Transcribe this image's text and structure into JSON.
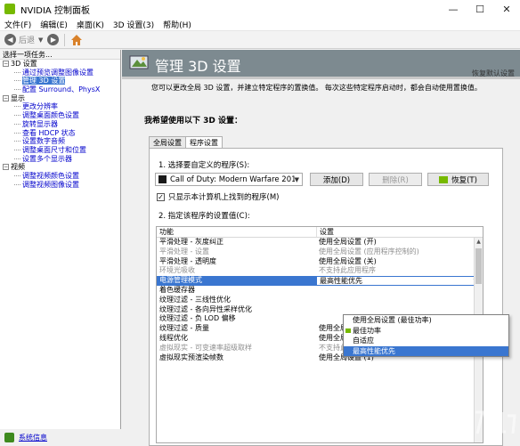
{
  "window": {
    "title": "NVIDIA 控制面板",
    "controls": [
      "—",
      "☐",
      "✕"
    ]
  },
  "menu": [
    "文件(F)",
    "编辑(E)",
    "桌面(K)",
    "3D 设置(3)",
    "帮助(H)"
  ],
  "toolbar": {
    "back_label": "后退",
    "back_glyph": "◀",
    "forward_glyph": "▶",
    "caret": "▼"
  },
  "sidebar": {
    "header": "选择一项任务...",
    "tree": [
      {
        "kind": "category",
        "label": "3D 设置",
        "expander": "−"
      },
      {
        "kind": "child",
        "label": "通过预览调整图像设置"
      },
      {
        "kind": "child",
        "label": "管理 3D 设置",
        "selected": true
      },
      {
        "kind": "child",
        "label": "配置 Surround、PhysX"
      },
      {
        "kind": "category",
        "label": "显示",
        "expander": "−"
      },
      {
        "kind": "child",
        "label": "更改分辨率"
      },
      {
        "kind": "child",
        "label": "调整桌面颜色设置"
      },
      {
        "kind": "child",
        "label": "旋转显示器"
      },
      {
        "kind": "child",
        "label": "查看 HDCP 状态"
      },
      {
        "kind": "child",
        "label": "设置数字音频"
      },
      {
        "kind": "child",
        "label": "调整桌面尺寸和位置"
      },
      {
        "kind": "child",
        "label": "设置多个显示器"
      },
      {
        "kind": "category",
        "label": "视频",
        "expander": "−"
      },
      {
        "kind": "child",
        "label": "调整视频颜色设置"
      },
      {
        "kind": "child",
        "label": "调整视频图像设置"
      }
    ],
    "footer_link": "系统信息"
  },
  "main": {
    "title": "管理 3D 设置",
    "restore_defaults": "恢复默认设置",
    "description": "您可以更改全局 3D 设置，并建立特定程序的置换值。 每次这些特定程序启动时，都会自动使用置换值。",
    "section_title": "我希望使用以下 3D 设置：",
    "tabs": [
      {
        "label": "全局设置",
        "active": false
      },
      {
        "label": "程序设置",
        "active": true
      }
    ],
    "step1_label": "1. 选择要自定义的程序(S):",
    "program_selected": "Call of Duty: Modern Warfare 2019...",
    "buttons": {
      "add": "添加(D)",
      "remove": "删除(R)",
      "restore": "恢复(T)"
    },
    "only_show_label": "只显示本计算机上找到的程序(M)",
    "only_show_checked": true,
    "step2_label": "2. 指定该程序的设置值(C):",
    "grid": {
      "columns": [
        "功能",
        "设置"
      ],
      "rows": [
        {
          "feature": "平滑处理 - 灰度纠正",
          "setting": "使用全局设置 (开)",
          "muted": false
        },
        {
          "feature": "平滑处理 - 设置",
          "setting": "使用全局设置 (应用程序控制的)",
          "muted": true
        },
        {
          "feature": "平滑处理 - 透明度",
          "setting": "使用全局设置 (关)",
          "muted": false
        },
        {
          "feature": "环境光吸收",
          "setting": "不支持此应用程序",
          "muted": true
        },
        {
          "feature": "电源管理模式",
          "setting": "最高性能优先",
          "selected": true
        },
        {
          "feature": "着色缓存器",
          "setting": "",
          "muted": false
        },
        {
          "feature": "纹理过滤 - 三线性优化",
          "setting": "",
          "muted": false
        },
        {
          "feature": "纹理过滤 - 各向异性采样优化",
          "setting": "",
          "muted": false
        },
        {
          "feature": "纹理过滤 - 负 LOD 偏移",
          "setting": "",
          "muted": false
        },
        {
          "feature": "纹理过滤 - 质量",
          "setting": "使用全局设置 (质量)",
          "muted": false
        },
        {
          "feature": "线程优化",
          "setting": "使用全局设置 (自动)",
          "muted": false
        },
        {
          "feature": "虚拟现实 - 可变速率超级取样",
          "setting": "不支持此应用程序",
          "muted": true
        },
        {
          "feature": "虚拟现实预渲染帧数",
          "setting": "使用全局设置 (1)",
          "muted": false
        }
      ]
    },
    "dropdown_options": [
      {
        "label": "使用全局设置 (最佳功率)",
        "nvidia": false,
        "highlight": false
      },
      {
        "label": "最佳功率",
        "nvidia": true,
        "highlight": false
      },
      {
        "label": "自适应",
        "nvidia": false,
        "highlight": false
      },
      {
        "label": "最高性能优先",
        "nvidia": false,
        "highlight": true
      }
    ]
  },
  "colors": {
    "accent": "#3a76d0",
    "nvidia_green": "#76b900",
    "banner": "#7d8a90"
  }
}
